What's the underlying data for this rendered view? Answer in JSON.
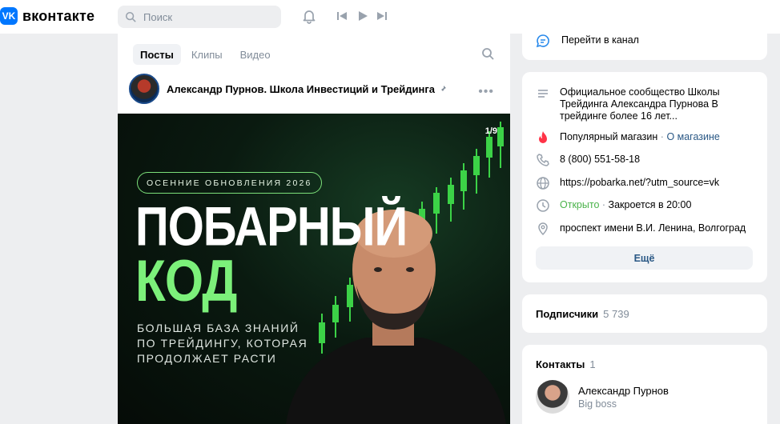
{
  "header": {
    "logo_text": "вконтакте",
    "logo_mark": "VK",
    "search_placeholder": "Поиск",
    "icons": [
      "search-icon",
      "bell-icon",
      "prev-track-icon",
      "play-icon",
      "next-track-icon"
    ]
  },
  "post": {
    "tabs": [
      {
        "label": "Посты",
        "active": true
      },
      {
        "label": "Клипы",
        "active": false
      },
      {
        "label": "Видео",
        "active": false
      }
    ],
    "author_name": "Александр Пурнов. Школа Инвестиций и Трейдинга",
    "more_label": "•••",
    "banner": {
      "counter": "1/9",
      "pill": "ОСЕННИЕ ОБНОВЛЕНИЯ 2026",
      "title_line1": "ПОБАРНЫЙ",
      "title_line2": "КОД",
      "subtitle": "БОЛЬШАЯ БАЗА ЗНАНИЙ\nПО ТРЕЙДИНГУ, КОТОРАЯ\nПРОДОЛЖАЕТ РАСТИ"
    }
  },
  "sidebar": {
    "channel_link": "Перейти в канал",
    "info": {
      "description": "Официальное сообщество Школы Трейдинга Александра Пурнова В трейдинге более 16 лет...",
      "shop_label": "Популярный магазин",
      "shop_link": "О магазине",
      "separator": "·",
      "phone": "8 (800) 551-58-18",
      "website": "https://pobarka.net/?utm_source=vk",
      "status_open": "Открыто",
      "status_close": "Закроется в 20:00",
      "address": "проспект имени В.И. Ленина, Волгоград",
      "more_button": "Ещё"
    },
    "subscribers": {
      "label": "Подписчики",
      "count": "5 739"
    },
    "contacts": {
      "label": "Контакты",
      "count": "1",
      "person_name": "Александр Пурнов",
      "person_role": "Big boss"
    }
  },
  "colors": {
    "accent": "#0077ff",
    "link": "#2a5885",
    "green": "#4bb34b",
    "banner_green": "#7cf07a"
  }
}
